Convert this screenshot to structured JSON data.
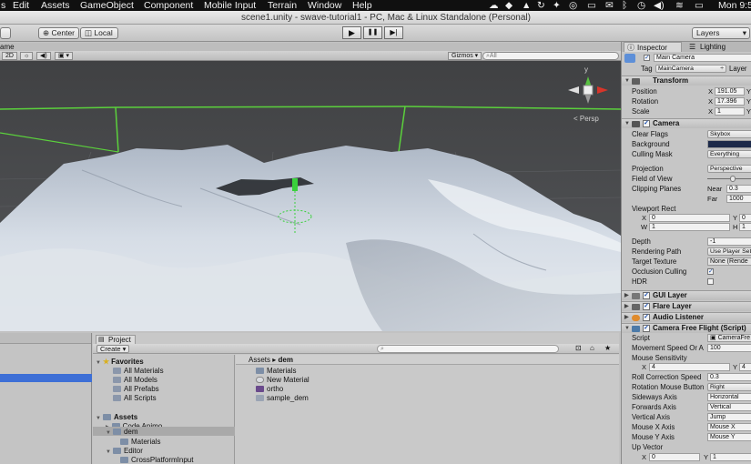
{
  "menubar": {
    "items": [
      "Edit",
      "Assets",
      "GameObject",
      "Component",
      "Mobile Input",
      "Terrain",
      "Window",
      "Help"
    ],
    "clock": "Mon 9:5"
  },
  "titlebar": {
    "title": "scene1.unity - swave-tutorial1 - PC, Mac & Linux Standalone (Personal)"
  },
  "toolbar": {
    "center_label": "Center",
    "local_label": "Local",
    "play_icon": "▶",
    "pause_icon": "❚❚",
    "step_icon": "▶|",
    "layers_label": "Layers"
  },
  "scene": {
    "tab_label": "ame",
    "mode_2d": "2D",
    "gizmos_label": "Gizmos",
    "search_placeholder": "All",
    "persp_label": "Persp",
    "gizmo_y": "y"
  },
  "hierarchy": {},
  "project": {
    "tab_label": "Project",
    "create_label": "Create",
    "favorites_label": "Favorites",
    "favorites": [
      "All Materials",
      "All Models",
      "All Prefabs",
      "All Scripts"
    ],
    "assets_label": "Assets",
    "asset_tree": [
      "Code Animo",
      "dem",
      "Materials",
      "Editor",
      "CrossPlatformInput"
    ],
    "breadcrumb_root": "Assets",
    "breadcrumb_current": "dem",
    "files": [
      "Materials",
      "New Material",
      "ortho",
      "sample_dem"
    ]
  },
  "inspector": {
    "tab_inspector": "Inspector",
    "tab_lighting": "Lighting",
    "object_name": "Main Camera",
    "tag_label": "Tag",
    "tag_value": "MainCamera",
    "layer_label": "Layer",
    "transform": {
      "title": "Transform",
      "position_label": "Position",
      "position_x": "191.05",
      "rotation_label": "Rotation",
      "rotation_x": "17.396",
      "scale_label": "Scale",
      "scale_x": "1",
      "x": "X",
      "y": "Y"
    },
    "camera": {
      "title": "Camera",
      "clear_flags_label": "Clear Flags",
      "clear_flags_value": "Skybox",
      "background_label": "Background",
      "culling_mask_label": "Culling Mask",
      "culling_mask_value": "Everything",
      "projection_label": "Projection",
      "projection_value": "Perspective",
      "fov_label": "Field of View",
      "clipping_label": "Clipping Planes",
      "near_label": "Near",
      "near_value": "0.3",
      "far_label": "Far",
      "far_value": "1000",
      "viewport_label": "Viewport Rect",
      "vp_x_label": "X",
      "vp_x_value": "0",
      "vp_y_label": "Y",
      "vp_y_value": "0",
      "vp_w_label": "W",
      "vp_w_value": "1",
      "vp_h_label": "H",
      "vp_h_value": "1",
      "depth_label": "Depth",
      "depth_value": "-1",
      "render_path_label": "Rendering Path",
      "render_path_value": "Use Player Sett",
      "target_texture_label": "Target Texture",
      "target_texture_value": "None (Rende",
      "occlusion_label": "Occlusion Culling",
      "hdr_label": "HDR",
      "background_color": "#1d2a4a"
    },
    "components": [
      "GUI Layer",
      "Flare Layer",
      "Audio Listener",
      "Camera Free Flight (Script)"
    ],
    "script": {
      "script_label": "Script",
      "script_value": "CameraFre",
      "move_speed_label": "Movement Speed Or A",
      "move_speed_value": "100",
      "mouse_sens_label": "Mouse Sensitivity",
      "ms_x_label": "X",
      "ms_x_value": "4",
      "ms_y_label": "Y",
      "ms_y_value": "4",
      "roll_speed_label": "Roll Correction Speed",
      "roll_speed_value": "0.3",
      "rot_button_label": "Rotation Mouse Button",
      "rot_button_value": "Right",
      "sideways_label": "Sideways Axis",
      "sideways_value": "Horizontal",
      "forwards_label": "Forwards Axis",
      "forwards_value": "Vertical",
      "vertical_label": "Vertical Axis",
      "vertical_value": "Jump",
      "mouse_x_label": "Mouse X Axis",
      "mouse_x_value": "Mouse X",
      "mouse_y_label": "Mouse Y Axis",
      "mouse_y_value": "Mouse Y",
      "up_vector_label": "Up Vector",
      "up_x_label": "X",
      "up_x_value": "0",
      "up_y_label": "Y",
      "up_y_value": "1"
    }
  }
}
